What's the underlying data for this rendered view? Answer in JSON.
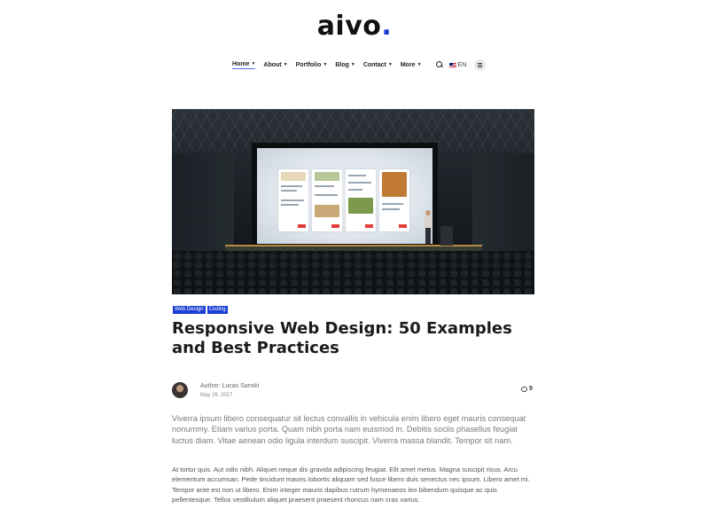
{
  "logo": {
    "text": "aivo",
    "dot": ".",
    "dot_color": "#1a3fd6"
  },
  "nav": {
    "items": [
      {
        "label": "Home",
        "active": true
      },
      {
        "label": "About"
      },
      {
        "label": "Portfolio"
      },
      {
        "label": "Blog"
      },
      {
        "label": "Contact"
      },
      {
        "label": "More"
      }
    ],
    "search_icon": "search-icon",
    "language": "EN",
    "menu_icon": "hamburger-icon"
  },
  "post": {
    "tags": [
      "Web Design",
      "Coding"
    ],
    "title": "Responsive Web Design: 50 Examples and Best Practices",
    "author": "Author: Lucas Sanski",
    "date": "May 26, 2017",
    "comments_count": "9",
    "lead": "Viverra ipsum libero consequatur sit lectus convallis in vehicula enim libero eget mauris consequat nonummy. Etiam varius porta. Quam nibh porta nam euismod in. Debitis sociis phasellus feugiat luctus diam. Vitae aenean odio ligula interdum suscipit. Viverra massa blandit. Tempor sit nam.",
    "paragraph": "At tortor quis. Aut odio nibh. Aliquet neque dis gravida adipiscing feugiat. Elit amet metus. Magna suscipit risus. Arcu elementum accumsan. Pede tincidunt mauris lobortis aliquam sed fusce libero duis senectus nec ipsum. Libero amet mi. Tempor ante est non ut libero. Enim integer mauris dapibus rutrum hymenaeos leo bibendum quisque ac quis pellentesque. Tellus vestibulum aliquet praesent praesent rhoncus nam cras varius."
  },
  "colors": {
    "accent": "#1a3fd6",
    "nav_active_underline": "#4a6cf7"
  }
}
